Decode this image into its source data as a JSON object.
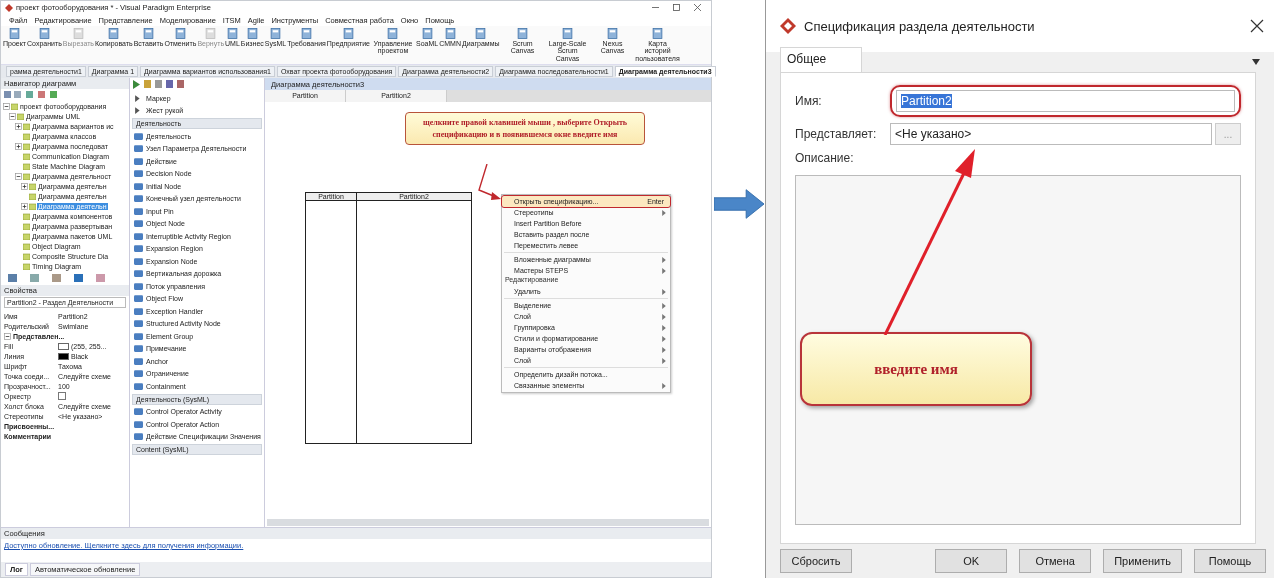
{
  "app": {
    "title": "проект фотооборудования * - Visual Paradigm Enterprise",
    "menu": [
      "Файл",
      "Редактирование",
      "Представление",
      "Моделирование",
      "ITSM",
      "Agile",
      "Инструменты",
      "Совместная работа",
      "Окно",
      "Помощь"
    ],
    "toolbar": [
      {
        "label": "Проект",
        "disabled": false
      },
      {
        "label": "Сохранить",
        "disabled": false
      },
      {
        "label": "Вырезать",
        "disabled": true
      },
      {
        "label": "Копировать",
        "disabled": false
      },
      {
        "label": "Вставить",
        "disabled": false
      },
      {
        "label": "Отменить",
        "disabled": false
      },
      {
        "label": "Вернуть",
        "disabled": true
      },
      {
        "label": "UML",
        "disabled": false
      },
      {
        "label": "Бизнес",
        "disabled": false
      },
      {
        "label": "SysML",
        "disabled": false
      },
      {
        "label": "Требования",
        "disabled": false
      },
      {
        "label": "Предприятие",
        "disabled": false
      },
      {
        "label": "Управление проектом",
        "disabled": false
      },
      {
        "label": "SoaML",
        "disabled": false
      },
      {
        "label": "CMMN",
        "disabled": false
      },
      {
        "label": "Диаграммы",
        "disabled": false
      },
      {
        "label": "Scrum Canvas",
        "disabled": false
      },
      {
        "label": "Large-Scale Scrum Canvas",
        "disabled": false
      },
      {
        "label": "Nexus Canvas",
        "disabled": false
      },
      {
        "label": "Карта историй пользователя",
        "disabled": false
      }
    ],
    "doc_tabs": [
      {
        "label": "рамма деятельности1",
        "selected": false
      },
      {
        "label": "Диаграмма 1",
        "selected": false
      },
      {
        "label": "Диаграмма вариантов использования1",
        "selected": false
      },
      {
        "label": "Охват проекта фотооборудования",
        "selected": false
      },
      {
        "label": "Диаграмма деятельности2",
        "selected": false
      },
      {
        "label": "Диаграмма последовательности1",
        "selected": false
      },
      {
        "label": "Диаграмма деятельности3",
        "selected": true
      }
    ],
    "navigator": {
      "title": "Навигатор диаграмм",
      "tree": [
        {
          "label": "проект фотооборудования",
          "selected": false,
          "expanded": true,
          "children": [
            {
              "label": "Диаграммы UML",
              "selected": false,
              "expanded": true,
              "children": [
                {
                  "label": "Диаграмма вариантов ис",
                  "selected": false,
                  "expanded": false
                },
                {
                  "label": "Диаграмма классов",
                  "selected": false
                },
                {
                  "label": "Диаграмма последоват",
                  "selected": false,
                  "expanded": false
                },
                {
                  "label": "Communication Diagram",
                  "selected": false
                },
                {
                  "label": "State Machine Diagram",
                  "selected": false
                },
                {
                  "label": "Диаграмма деятельност",
                  "selected": false,
                  "expanded": true,
                  "children": [
                    {
                      "label": "Диаграмма деятельн",
                      "selected": false,
                      "expanded": false
                    },
                    {
                      "label": "Диаграмма деятельн",
                      "selected": false
                    },
                    {
                      "label": "Диаграмма деятельн",
                      "selected": true,
                      "expanded": false
                    }
                  ]
                },
                {
                  "label": "Диаграмма компонентов",
                  "selected": false
                },
                {
                  "label": "Диаграмма развертыван",
                  "selected": false
                },
                {
                  "label": "Диаграмма пакетов UML",
                  "selected": false
                },
                {
                  "label": "Object Diagram",
                  "selected": false
                },
                {
                  "label": "Composite Structure Dia",
                  "selected": false
                },
                {
                  "label": "Timing Diagram",
                  "selected": false
                }
              ]
            }
          ]
        }
      ]
    },
    "properties": {
      "title": "Свойства",
      "selector": "Partition2 - Раздел Деятельности",
      "rows": [
        {
          "kind": "text",
          "name": "Имя",
          "value": "Partition2"
        },
        {
          "kind": "text",
          "name": "Родительский",
          "value": "Swimlane"
        },
        {
          "kind": "group",
          "name": "Представлен...",
          "expanded": true
        },
        {
          "kind": "swatch",
          "name": "Fill",
          "value": "(255, 255...",
          "color": "#ffffff"
        },
        {
          "kind": "swatch",
          "name": "Линия",
          "value": "Black",
          "color": "#000000"
        },
        {
          "kind": "text",
          "name": "Шрифт",
          "value": "Тахома"
        },
        {
          "kind": "text",
          "name": "Точка соеди...",
          "value": "Следуйте схеме"
        },
        {
          "kind": "text",
          "name": "Прозрачност...",
          "value": "100"
        },
        {
          "kind": "checkbox",
          "name": "Оркестр",
          "checked": false
        },
        {
          "kind": "text",
          "name": "Холст блока",
          "value": "Следуйте схеме"
        },
        {
          "kind": "text",
          "name": "Стереотипы",
          "value": "<Не указано>"
        },
        {
          "kind": "bold",
          "name": "Присвоенны..."
        },
        {
          "kind": "bold",
          "name": "Комментарии"
        }
      ]
    },
    "palette": [
      {
        "kind": "tool",
        "label": "Маркер"
      },
      {
        "kind": "tool",
        "label": "Жест рукой"
      },
      {
        "kind": "group",
        "label": "Деятельность"
      },
      {
        "kind": "item",
        "label": "Деятельность"
      },
      {
        "kind": "item",
        "label": "Узел Параметра Деятельности"
      },
      {
        "kind": "item",
        "label": "Действие"
      },
      {
        "kind": "item",
        "label": "Decision Node"
      },
      {
        "kind": "item",
        "label": "Initial Node"
      },
      {
        "kind": "item",
        "label": "Конечный узел деятельности"
      },
      {
        "kind": "item",
        "label": "Input Pin"
      },
      {
        "kind": "item",
        "label": "Object Node"
      },
      {
        "kind": "item",
        "label": "Interruptible Activity Region"
      },
      {
        "kind": "item",
        "label": "Expansion Region"
      },
      {
        "kind": "item",
        "label": "Expansion Node"
      },
      {
        "kind": "item",
        "label": "Вертикальная дорожка"
      },
      {
        "kind": "item",
        "label": "Поток управления"
      },
      {
        "kind": "item",
        "label": "Object Flow"
      },
      {
        "kind": "item",
        "label": "Exception Handler"
      },
      {
        "kind": "item",
        "label": "Structured Activity Node"
      },
      {
        "kind": "item",
        "label": "Element Group"
      },
      {
        "kind": "item",
        "label": "Примечание"
      },
      {
        "kind": "item",
        "label": "Anchor"
      },
      {
        "kind": "item",
        "label": "Ограничение"
      },
      {
        "kind": "item",
        "label": "Containment"
      },
      {
        "kind": "group",
        "label": "Деятельность (SysML)"
      },
      {
        "kind": "item",
        "label": "Control Operator Activity"
      },
      {
        "kind": "item",
        "label": "Control Operator Action"
      },
      {
        "kind": "item",
        "label": "Действие Спецификации Значения"
      },
      {
        "kind": "group",
        "label": "Content (SysML)"
      }
    ],
    "editor": {
      "title": "Диаграмма деятельности3",
      "lane_headers": [
        "Partition",
        "Partition2"
      ],
      "note": "щелкните правой клавишей мыши , выберите Открыть спецификацию и в появившемся окне введите имя",
      "lanes": [
        "Partition",
        "Partition2"
      ],
      "context_menu": [
        {
          "kind": "item",
          "label": "Открыть спецификацию...",
          "shortcut": "Enter",
          "submenu": false,
          "selected": true
        },
        {
          "kind": "item",
          "label": "Стереотипы",
          "submenu": true,
          "selected": false
        },
        {
          "kind": "item",
          "label": "Insert Partition Before",
          "submenu": false,
          "selected": false
        },
        {
          "kind": "item",
          "label": "Вставить раздел после",
          "submenu": false,
          "selected": false
        },
        {
          "kind": "item",
          "label": "Переместить левее",
          "submenu": false,
          "selected": false
        },
        {
          "kind": "separator"
        },
        {
          "kind": "item",
          "label": "Вложенные диаграммы",
          "submenu": true,
          "selected": false
        },
        {
          "kind": "item",
          "label": "Мастеры STEPS",
          "submenu": true,
          "selected": false
        },
        {
          "kind": "header",
          "label": "Редактирование"
        },
        {
          "kind": "item",
          "label": "Удалить",
          "submenu": true,
          "selected": false
        },
        {
          "kind": "separator"
        },
        {
          "kind": "item",
          "label": "Выделение",
          "submenu": true,
          "selected": false
        },
        {
          "kind": "item",
          "label": "Слой",
          "submenu": true,
          "selected": false
        },
        {
          "kind": "item",
          "label": "Группировка",
          "submenu": true,
          "selected": false
        },
        {
          "kind": "item",
          "label": "Стили и форматирование",
          "submenu": true,
          "selected": false
        },
        {
          "kind": "item",
          "label": "Варианты отображения",
          "submenu": true,
          "selected": false
        },
        {
          "kind": "item",
          "label": "Слой",
          "submenu": true,
          "selected": false
        },
        {
          "kind": "separator"
        },
        {
          "kind": "item",
          "label": "Определить дизайн потока...",
          "submenu": false,
          "selected": false
        },
        {
          "kind": "item",
          "label": "Связанные элементы",
          "submenu": true,
          "selected": false
        }
      ]
    },
    "messages": {
      "title": "Сообщения",
      "link": "Доступно обновление. Щелкните здесь для получения информации."
    },
    "bottom_tabs": [
      {
        "label": "Лог",
        "selected": true
      },
      {
        "label": "Автоматическое обновление",
        "selected": false
      }
    ]
  },
  "dialog": {
    "title": "Спецификация раздела деятельности",
    "tabs": [
      {
        "label": "Общее",
        "selected": true
      }
    ],
    "name_label": "Имя:",
    "name_value": "Partition2",
    "represents_label": "Представляет:",
    "represents_value": "<Не указано>",
    "browse": "...",
    "description_label": "Описание:",
    "note": "введите имя",
    "left_buttons": [
      "Сбросить"
    ],
    "right_buttons": [
      "OK",
      "Отмена",
      "Применить",
      "Помощь"
    ]
  }
}
